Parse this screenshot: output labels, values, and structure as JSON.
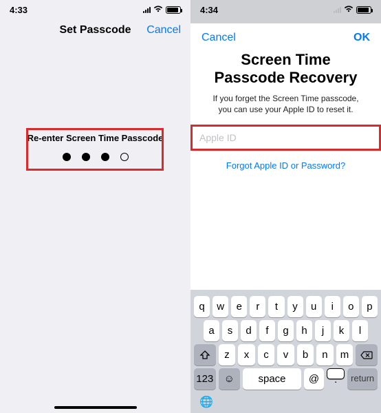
{
  "left": {
    "time": "4:33",
    "nav_title": "Set Passcode",
    "cancel": "Cancel",
    "prompt": "Re-enter Screen Time Passcode",
    "dots_filled": 3,
    "dots_total": 4
  },
  "right": {
    "time": "4:34",
    "cancel": "Cancel",
    "ok": "OK",
    "title_line1": "Screen Time",
    "title_line2": "Passcode Recovery",
    "subtext": "If you forget the Screen Time passcode, you can use your Apple ID to reset it.",
    "placeholder": "Apple ID",
    "forgot": "Forgot Apple ID or Password?"
  },
  "keyboard": {
    "row1": [
      "q",
      "w",
      "e",
      "r",
      "t",
      "y",
      "u",
      "i",
      "o",
      "p"
    ],
    "row2": [
      "a",
      "s",
      "d",
      "f",
      "g",
      "h",
      "j",
      "k",
      "l"
    ],
    "row3": [
      "z",
      "x",
      "c",
      "v",
      "b",
      "n",
      "m"
    ],
    "numKey": "123",
    "space": "space",
    "at": "@",
    "dot": ".",
    "ret": "return",
    "globe": "🌐",
    "emoji": "☺"
  }
}
